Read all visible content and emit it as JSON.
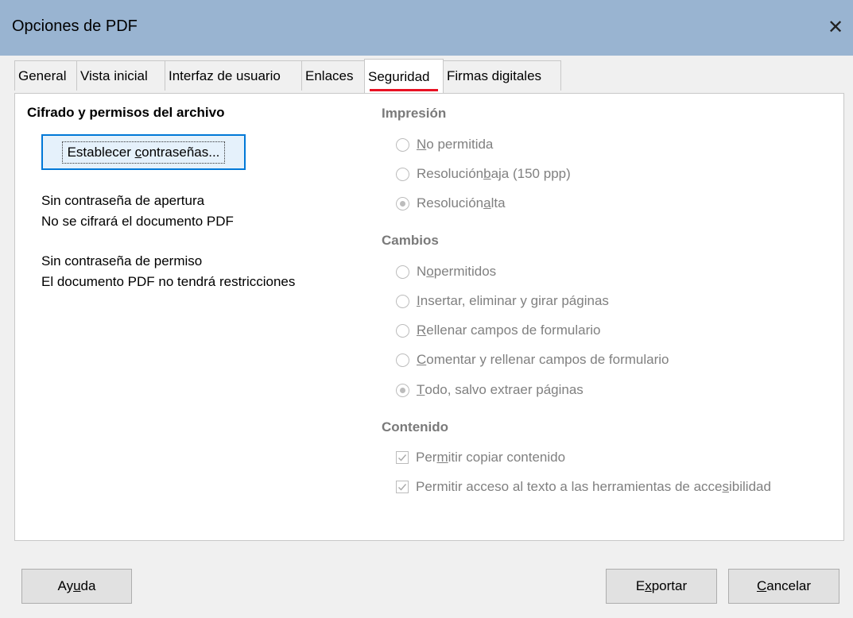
{
  "window": {
    "title": "Opciones de PDF",
    "close_glyph": "✕"
  },
  "tabs": [
    {
      "label": "General"
    },
    {
      "label": "Vista inicial"
    },
    {
      "label": "Interfaz de usuario"
    },
    {
      "label": "Enlaces"
    },
    {
      "label": "Seguridad",
      "active": true
    },
    {
      "label": "Firmas digitales"
    }
  ],
  "encryption": {
    "heading": "Cifrado y permisos del archivo",
    "set_passwords_button": {
      "pre": "Establecer ",
      "mnemonic": "c",
      "post": "ontraseñas..."
    },
    "open_password_status": "Sin contraseña de apertura",
    "encrypt_status": "No se cifrará el documento PDF",
    "permission_password_status": "Sin contraseña de permiso",
    "restrictions_status": "El documento PDF no tendrá restricciones"
  },
  "printing": {
    "heading": "Impresión",
    "options": [
      {
        "pre": "",
        "mnemonic": "N",
        "post": "o permitida",
        "selected": false
      },
      {
        "pre": "Resolución ",
        "mnemonic": "b",
        "post": "aja (150 ppp)",
        "selected": false
      },
      {
        "pre": "Resolución ",
        "mnemonic": "a",
        "post": "lta",
        "selected": true
      }
    ]
  },
  "changes": {
    "heading": "Cambios",
    "options": [
      {
        "pre": "N",
        "mnemonic": "o",
        "post": " permitidos",
        "selected": false
      },
      {
        "pre": "",
        "mnemonic": "I",
        "post": "nsertar, eliminar y girar páginas",
        "selected": false
      },
      {
        "pre": "",
        "mnemonic": "R",
        "post": "ellenar campos de formulario",
        "selected": false
      },
      {
        "pre": "",
        "mnemonic": "C",
        "post": "omentar y rellenar campos de formulario",
        "selected": false
      },
      {
        "pre": "",
        "mnemonic": "T",
        "post": "odo, salvo extraer páginas",
        "selected": true
      }
    ]
  },
  "content": {
    "heading": "Contenido",
    "options": [
      {
        "pre": "Per",
        "mnemonic": "m",
        "post": "itir copiar contenido",
        "checked": true
      },
      {
        "pre": "Permitir acceso al texto a las herramientas de acce",
        "mnemonic": "s",
        "post": "ibilidad",
        "checked": true
      }
    ]
  },
  "footer": {
    "help": {
      "pre": "Ay",
      "mnemonic": "u",
      "post": "da"
    },
    "export": {
      "pre": "E",
      "mnemonic": "x",
      "post": "portar"
    },
    "cancel": {
      "pre": "",
      "mnemonic": "C",
      "post": "ancelar"
    }
  }
}
